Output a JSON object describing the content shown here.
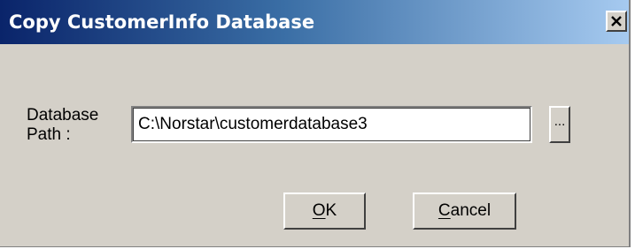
{
  "window": {
    "title": "Copy CustomerInfo Database"
  },
  "form": {
    "path_label": "Database Path :",
    "path_value": "C:\\Norstar\\customerdatabase3",
    "browse_label": "..."
  },
  "buttons": {
    "ok_label": "OK",
    "cancel_label": "Cancel"
  },
  "colors": {
    "title_bar_start": "#0a246a",
    "title_bar_end": "#a6caf0",
    "window_face": "#d4d0c8"
  },
  "icons": {
    "close": "close-icon"
  }
}
